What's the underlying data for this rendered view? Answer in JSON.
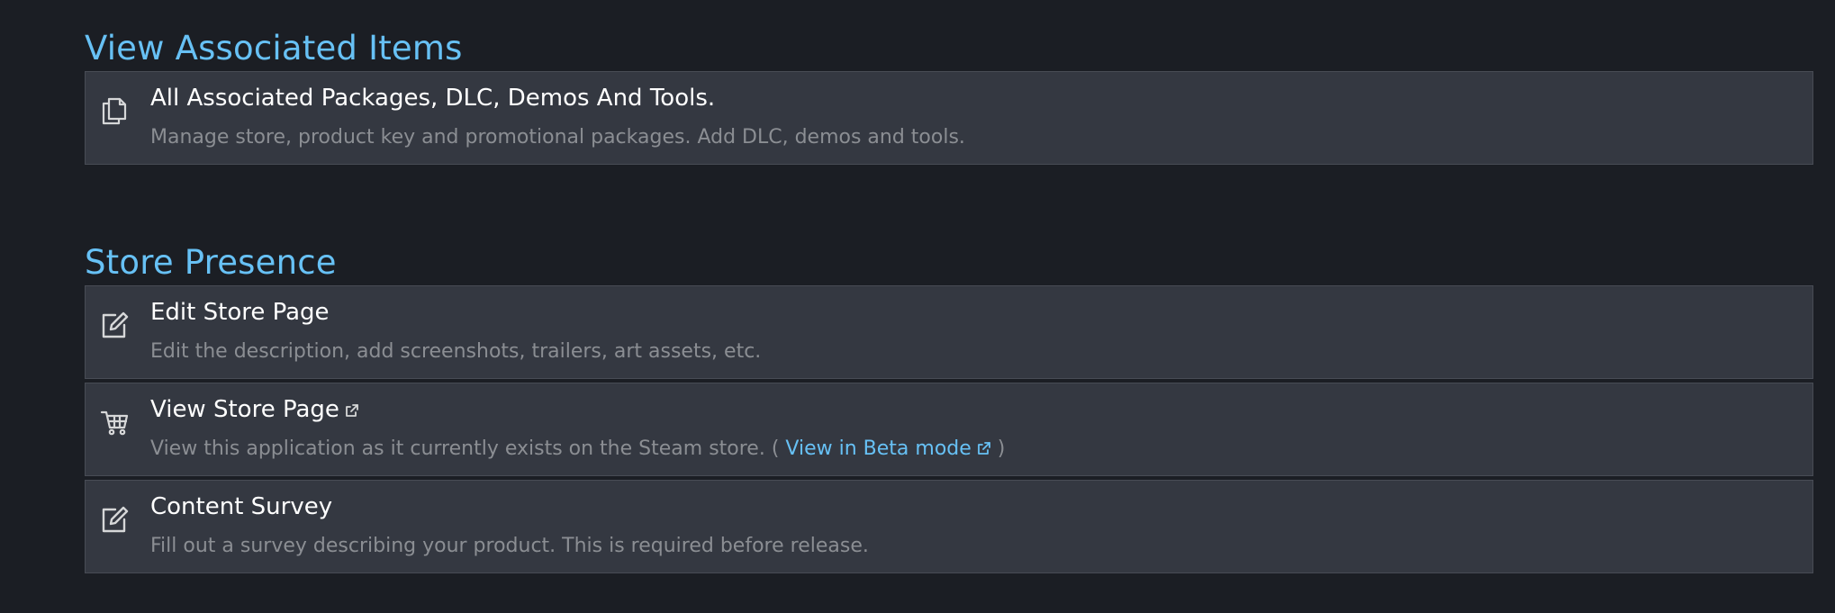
{
  "sections": [
    {
      "title": "View Associated Items",
      "items": [
        {
          "icon": "document-copy-icon",
          "title": "All Associated Packages, DLC, Demos And Tools.",
          "description": "Manage store, product key and promotional packages. Add DLC, demos and tools."
        }
      ]
    },
    {
      "title": "Store Presence",
      "items": [
        {
          "icon": "edit-icon",
          "title": "Edit Store Page",
          "description": "Edit the description, add screenshots, trailers, art assets, etc."
        },
        {
          "icon": "shopping-cart-icon",
          "title": "View Store Page",
          "description_prefix": "View this application as it currently exists on the Steam store. ( ",
          "link_label": "View in Beta mode",
          "description_suffix": " )"
        },
        {
          "icon": "edit-icon",
          "title": "Content Survey",
          "description": "Fill out a survey describing your product. This is required before release."
        }
      ]
    }
  ],
  "colors": {
    "background": "#1b1e24",
    "row_background": "#343841",
    "heading": "#67c1f5",
    "link": "#67c1f5",
    "title_text": "#ffffff",
    "description_text": "#8b8e93"
  }
}
